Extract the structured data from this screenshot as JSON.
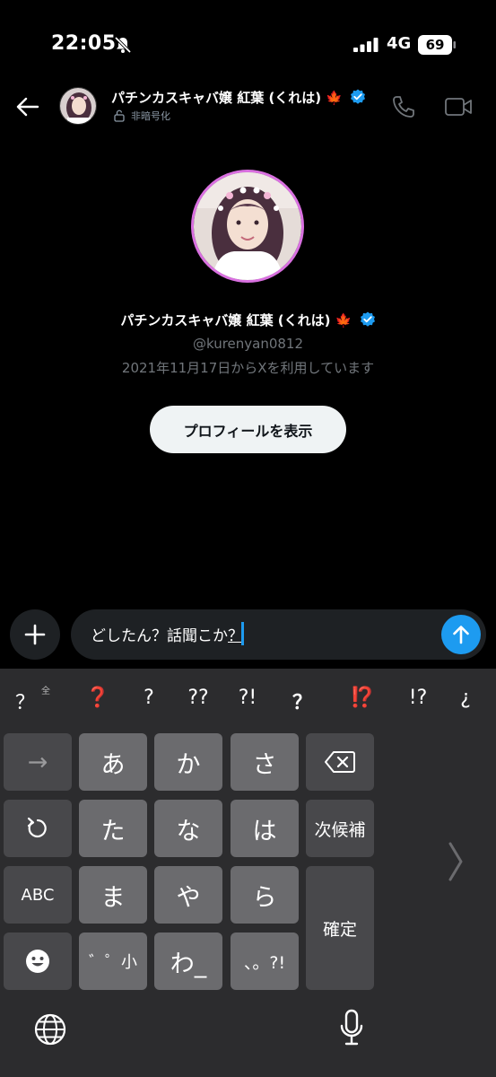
{
  "status": {
    "time": "22:05",
    "network": "4G",
    "battery": "69"
  },
  "header": {
    "name": "パチンカスキャバ嬢 紅葉 (くれは) 🍁",
    "subtitle": "非暗号化"
  },
  "profile": {
    "name": "パチンカスキャバ嬢 紅葉 (くれは) 🍁",
    "handle": "@kurenyan0812",
    "joined": "2021年11月17日からXを利用しています",
    "view_button": "プロフィールを表示"
  },
  "composer": {
    "text_before": "どしたん？話聞こか",
    "text_marked": "？"
  },
  "keyboard": {
    "candidates": [
      "？",
      "❓",
      "?",
      "??",
      "?!",
      "？",
      "⁉️",
      "!?",
      "¿"
    ],
    "candidate_sub": "全",
    "keys": {
      "arrow": "→",
      "a": "あ",
      "ka": "か",
      "sa": "さ",
      "ta": "た",
      "na": "な",
      "ha": "は",
      "next": "次候補",
      "abc": "ABC",
      "ma": "ま",
      "ya": "や",
      "ra": "ら",
      "confirm": "確定",
      "dakuten": "゛゜小",
      "wa": "わ_",
      "punct": "、。?!"
    }
  },
  "colors": {
    "accent": "#1d9bf0",
    "avatar_ring": "#d970e0",
    "verified": "#1d9bf0"
  }
}
